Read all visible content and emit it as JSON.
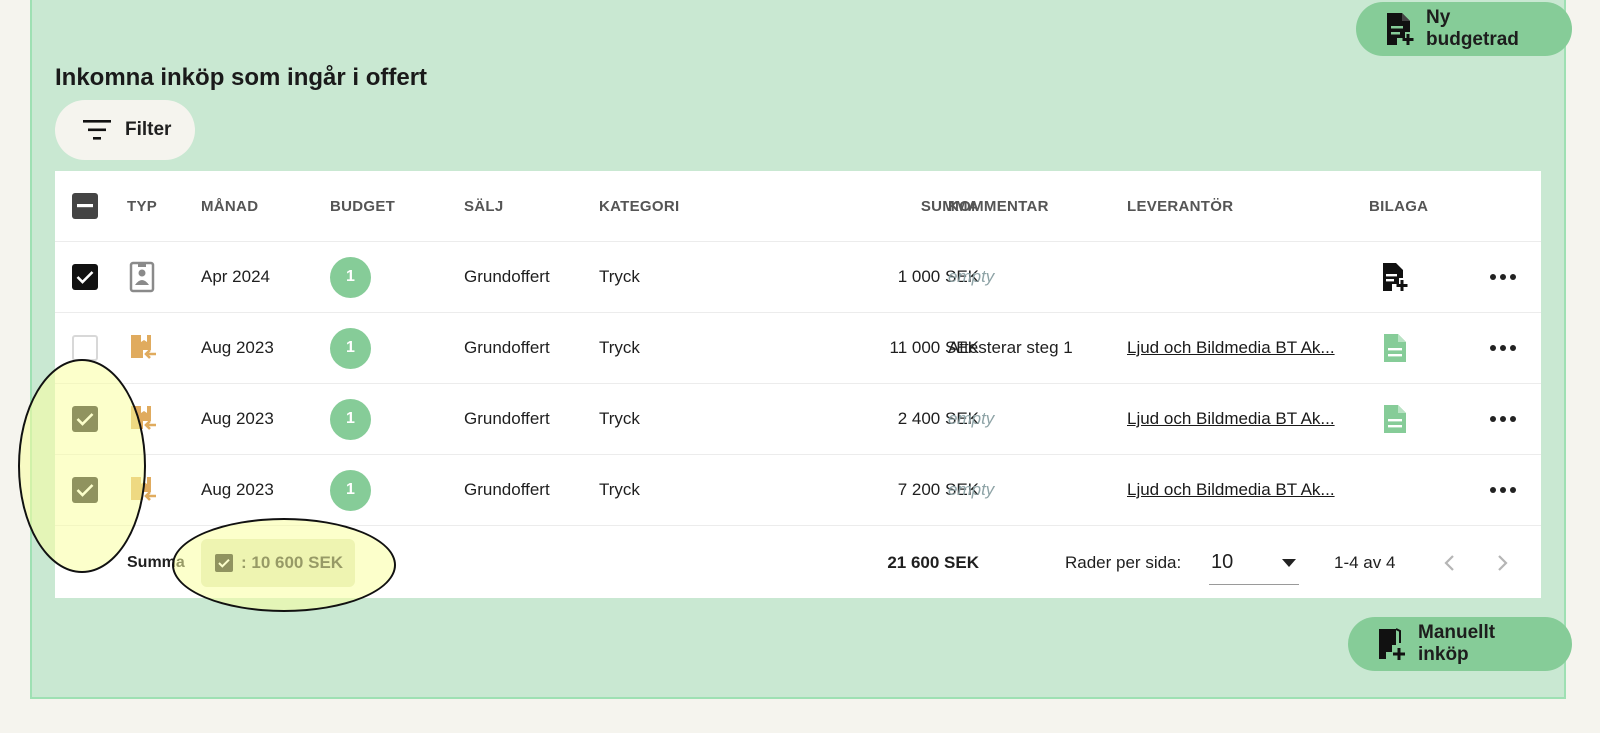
{
  "actions": {
    "new_budget_row": "Ny budgetrad",
    "manual_purchase": "Manuellt inköp"
  },
  "section": {
    "title": "Inkomna inköp som ingår i offert",
    "filter_label": "Filter"
  },
  "table": {
    "headers": {
      "typ": "TYP",
      "manad": "MÅNAD",
      "budget": "BUDGET",
      "salj": "SÄLJ",
      "kategori": "KATEGORI",
      "summa": "SUMMA",
      "kommentar": "KOMMENTAR",
      "leverantor": "LEVERANTÖR",
      "bilaga": "BILAGA"
    },
    "rows": [
      {
        "checked": true,
        "type_icon": "document-contact-icon",
        "month": "Apr 2024",
        "budget": "1",
        "salj": "Grundoffert",
        "kategori": "Tryck",
        "summa": "1 000 SEK",
        "kommentar": "empty",
        "leverantor": "",
        "bilaga_icon": "add-attachment-icon"
      },
      {
        "checked": false,
        "type_icon": "incoming-purchase-icon",
        "month": "Aug 2023",
        "budget": "1",
        "salj": "Grundoffert",
        "kategori": "Tryck",
        "summa": "11 000 SEK",
        "kommentar": "Attesterar steg 1",
        "leverantor": "Ljud och Bildmedia BT Ak...",
        "bilaga_icon": "document-icon"
      },
      {
        "checked": true,
        "type_icon": "incoming-purchase-icon",
        "month": "Aug 2023",
        "budget": "1",
        "salj": "Grundoffert",
        "kategori": "Tryck",
        "summa": "2 400 SEK",
        "kommentar": "empty",
        "leverantor": "Ljud och Bildmedia BT Ak...",
        "bilaga_icon": "document-icon"
      },
      {
        "checked": true,
        "type_icon": "incoming-purchase-icon",
        "month": "Aug 2023",
        "budget": "1",
        "salj": "Grundoffert",
        "kategori": "Tryck",
        "summa": "7 200 SEK",
        "kommentar": "empty",
        "leverantor": "Ljud och Bildmedia BT Ak...",
        "bilaga_icon": ""
      }
    ],
    "footer": {
      "summa_label": "Summa",
      "selected_sum": ": 10 600 SEK",
      "total": "21 600 SEK",
      "rows_per_page_label": "Rader per sida:",
      "rows_per_page": "10",
      "range": "1-4 av 4"
    }
  },
  "colors": {
    "panel_bg": "#c9e8d2",
    "accent_green": "#86cc98",
    "purchase_icon": "#e0ab5e",
    "highlight": "#faffa0"
  }
}
